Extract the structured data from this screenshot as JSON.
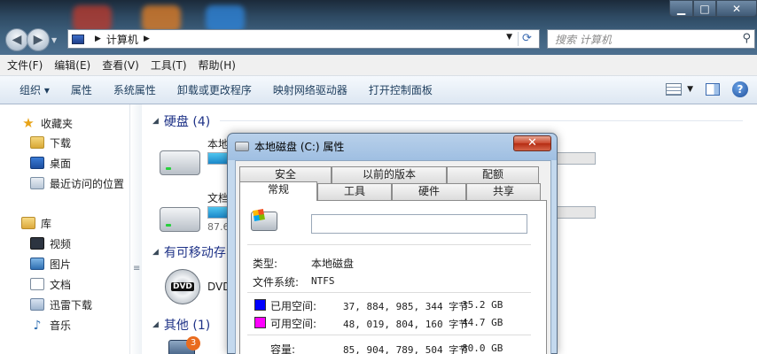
{
  "address_bar": {
    "crumb": "计算机"
  },
  "search": {
    "placeholder": "搜索 计算机"
  },
  "menu": [
    "文件(F)",
    "编辑(E)",
    "查看(V)",
    "工具(T)",
    "帮助(H)"
  ],
  "toolbar": [
    "组织 ▾",
    "属性",
    "系统属性",
    "卸载或更改程序",
    "映射网络驱动器",
    "打开控制面板"
  ],
  "sidebar": {
    "favorites_title": "收藏夹",
    "favorites": [
      "下载",
      "桌面",
      "最近访问的位置"
    ],
    "libraries_title": "库",
    "libraries": [
      "视频",
      "图片",
      "文档",
      "迅雷下载",
      "音乐"
    ]
  },
  "groups": {
    "hard_disks": "硬盘 (4)",
    "removable": "有可移动存",
    "other": "其他 (1)"
  },
  "drives": [
    {
      "label": "本地",
      "usage": 0.42,
      "sub": ""
    },
    {
      "label": "文档",
      "usage": 0.12,
      "sub": "87.6"
    }
  ],
  "dvd": {
    "badge": "DVD",
    "label": "DVD"
  },
  "other_badge": "3",
  "dialog": {
    "title": "本地磁盘 (C:) 属性",
    "close": "✕",
    "tabs_top": [
      "安全",
      "以前的版本",
      "配额"
    ],
    "tabs_bottom": [
      "常规",
      "工具",
      "硬件",
      "共享"
    ],
    "type_label": "类型:",
    "type_value": "本地磁盘",
    "fs_label": "文件系统:",
    "fs_value": "NTFS",
    "used_label": "已用空间:",
    "used_bytes": "37, 884, 985, 344 字节",
    "used_gb": "35.2 GB",
    "free_label": "可用空间:",
    "free_bytes": "48, 019, 804, 160 字节",
    "free_gb": "44.7 GB",
    "cap_label": "容量:",
    "cap_bytes": "85, 904, 789, 504 字节",
    "cap_gb": "80.0 GB",
    "colors": {
      "used": "#0000ff",
      "free": "#ff00ff"
    }
  }
}
